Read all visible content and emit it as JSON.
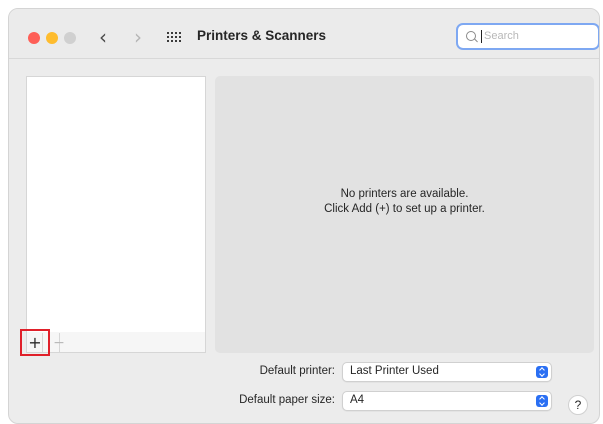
{
  "window": {
    "title": "Printers & Scanners"
  },
  "search": {
    "placeholder": "Search",
    "value": ""
  },
  "printer_list": {
    "add_label": "+",
    "remove_label": "−"
  },
  "detail": {
    "empty_line1": "No printers are available.",
    "empty_line2": "Click Add (+) to set up a printer."
  },
  "settings": {
    "default_printer_label": "Default printer:",
    "default_printer_value": "Last Printer Used",
    "default_paper_label": "Default paper size:",
    "default_paper_value": "A4"
  },
  "help": {
    "label": "?"
  },
  "colors": {
    "close": "#fe5f57",
    "minimize": "#febc2e",
    "zoom_inactive": "#d0d0d0",
    "accent": "#2a6ff3",
    "search_focus": "#7ea8f2",
    "highlight_box": "#e0202a"
  },
  "icons": {
    "back": "chevron-left-icon",
    "forward": "chevron-right-icon",
    "show_all": "grid-icon",
    "search": "magnifier-icon",
    "popup": "up-down-chevron-icon"
  }
}
